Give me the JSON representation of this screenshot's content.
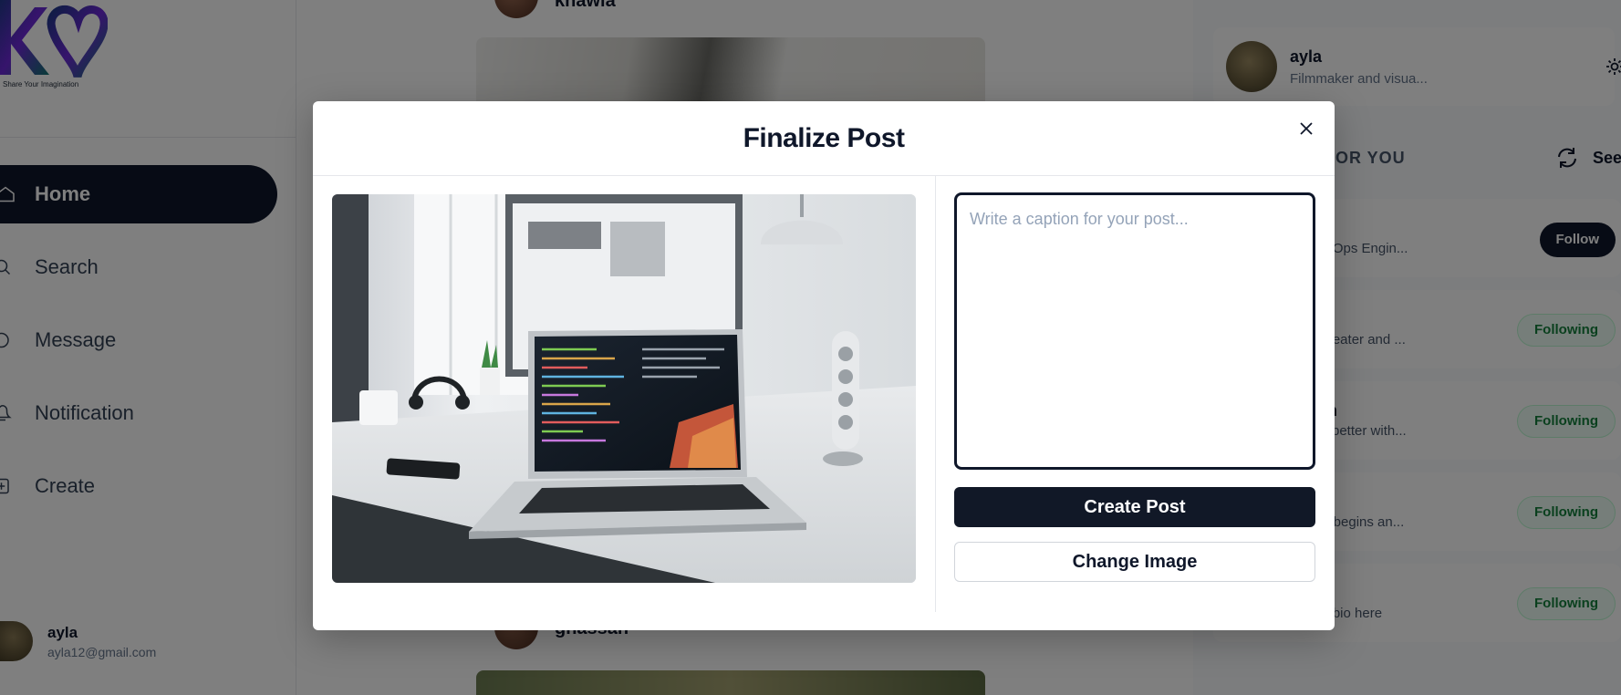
{
  "sidebar": {
    "logo_tagline": "Share Your Imagination",
    "items": [
      {
        "label": "Home",
        "icon": "home-icon",
        "active": true
      },
      {
        "label": "Search",
        "icon": "search-icon"
      },
      {
        "label": "Message",
        "icon": "message-icon"
      },
      {
        "label": "Notification",
        "icon": "bell-icon"
      },
      {
        "label": "Create",
        "icon": "plus-square-icon"
      }
    ],
    "user": {
      "name": "ayla",
      "email": "ayla12@gmail.com"
    }
  },
  "feed": {
    "posts": [
      {
        "author": "khawla"
      },
      {
        "author": "ghassan"
      }
    ]
  },
  "right_panel": {
    "profile": {
      "name": "ayla",
      "bio": "Filmmaker and visua..."
    },
    "suggestions_heading": "D FOR YOU",
    "see_all_label": "See",
    "suggestions": [
      {
        "name": "",
        "bio": "evOps Engin...",
        "action": "Follow"
      },
      {
        "name": "",
        "bio": "al eater and ...",
        "action": "Following"
      },
      {
        "name": "an",
        "bio": "is better with...",
        "action": "Following"
      },
      {
        "name": "",
        "bio": "fe begins an...",
        "action": "Following"
      },
      {
        "name": "",
        "bio": "le bio here",
        "action": "Following"
      }
    ]
  },
  "modal": {
    "title": "Finalize Post",
    "caption_placeholder": "Write a caption for your post...",
    "caption_value": "",
    "create_label": "Create Post",
    "change_label": "Change Image"
  },
  "colors": {
    "primary": "#0f172a",
    "overlay": "rgba(0,0,0,0.5)",
    "following_text": "#15803d"
  }
}
